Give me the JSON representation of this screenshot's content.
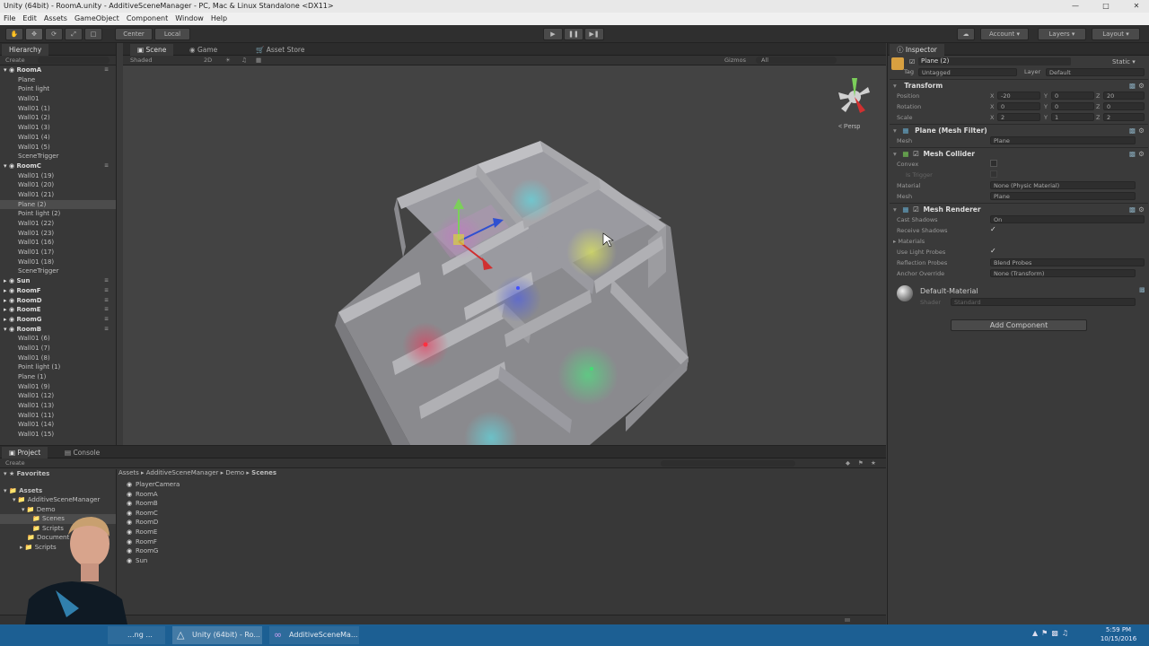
{
  "window": {
    "title": "Unity (64bit) - RoomA.unity - AdditiveSceneManager - PC, Mac & Linux Standalone <DX11>"
  },
  "menu": [
    "File",
    "Edit",
    "Assets",
    "GameObject",
    "Component",
    "Window",
    "Help"
  ],
  "toolbar": {
    "pivot": "Center",
    "space": "Local",
    "account": "Account",
    "layers": "Layers",
    "layout": "Layout"
  },
  "hierarchy": {
    "tab": "Hierarchy",
    "create": "Create",
    "rows": [
      {
        "label": "RoomA",
        "kind": "scene"
      },
      {
        "label": "Plane",
        "kind": "item"
      },
      {
        "label": "Point light",
        "kind": "item"
      },
      {
        "label": "Wall01",
        "kind": "item"
      },
      {
        "label": "Wall01 (1)",
        "kind": "item"
      },
      {
        "label": "Wall01 (2)",
        "kind": "item"
      },
      {
        "label": "Wall01 (3)",
        "kind": "item"
      },
      {
        "label": "Wall01 (4)",
        "kind": "item"
      },
      {
        "label": "Wall01 (5)",
        "kind": "item"
      },
      {
        "label": "SceneTrigger",
        "kind": "item"
      },
      {
        "label": "RoomC",
        "kind": "scene"
      },
      {
        "label": "Wall01 (19)",
        "kind": "item"
      },
      {
        "label": "Wall01 (20)",
        "kind": "item"
      },
      {
        "label": "Wall01 (21)",
        "kind": "item"
      },
      {
        "label": "Plane (2)",
        "kind": "sel"
      },
      {
        "label": "Point light (2)",
        "kind": "item"
      },
      {
        "label": "Wall01 (22)",
        "kind": "item"
      },
      {
        "label": "Wall01 (23)",
        "kind": "item"
      },
      {
        "label": "Wall01 (16)",
        "kind": "item"
      },
      {
        "label": "Wall01 (17)",
        "kind": "item"
      },
      {
        "label": "Wall01 (18)",
        "kind": "item"
      },
      {
        "label": "SceneTrigger",
        "kind": "item"
      },
      {
        "label": "Sun",
        "kind": "scene"
      },
      {
        "label": "RoomF",
        "kind": "scene"
      },
      {
        "label": "RoomD",
        "kind": "scene"
      },
      {
        "label": "RoomE",
        "kind": "scene"
      },
      {
        "label": "RoomG",
        "kind": "scene"
      },
      {
        "label": "RoomB",
        "kind": "scene"
      },
      {
        "label": "Wall01 (6)",
        "kind": "item"
      },
      {
        "label": "Wall01 (7)",
        "kind": "item"
      },
      {
        "label": "Wall01 (8)",
        "kind": "item"
      },
      {
        "label": "Point light (1)",
        "kind": "item"
      },
      {
        "label": "Plane (1)",
        "kind": "item"
      },
      {
        "label": "Wall01 (9)",
        "kind": "item"
      },
      {
        "label": "Wall01 (12)",
        "kind": "item"
      },
      {
        "label": "Wall01 (13)",
        "kind": "item"
      },
      {
        "label": "Wall01 (11)",
        "kind": "item"
      },
      {
        "label": "Wall01 (14)",
        "kind": "item"
      },
      {
        "label": "Wall01 (15)",
        "kind": "item"
      }
    ]
  },
  "scene": {
    "tabs": [
      "Scene",
      "Game",
      "Asset Store"
    ],
    "shading": "Shaded",
    "mode2d": "2D",
    "gizmos": "Gizmos",
    "search": "All",
    "persp": "< Persp"
  },
  "inspector": {
    "tab": "Inspector",
    "object_name": "Plane (2)",
    "static": "Static",
    "tag_label": "Tag",
    "tag_value": "Untagged",
    "layer_label": "Layer",
    "layer_value": "Default",
    "transform": {
      "title": "Transform",
      "position": {
        "label": "Position",
        "x": "-20",
        "y": "0",
        "z": "20"
      },
      "rotation": {
        "label": "Rotation",
        "x": "0",
        "y": "0",
        "z": "0"
      },
      "scale": {
        "label": "Scale",
        "x": "2",
        "y": "1",
        "z": "2"
      }
    },
    "mesh_filter": {
      "title": "Plane (Mesh Filter)",
      "mesh_label": "Mesh",
      "mesh_value": "Plane"
    },
    "mesh_collider": {
      "title": "Mesh Collider",
      "convex": "Convex",
      "is_trigger": "Is Trigger",
      "material_label": "Material",
      "material_value": "None (Physic Material)",
      "mesh_label": "Mesh",
      "mesh_value": "Plane"
    },
    "mesh_renderer": {
      "title": "Mesh Renderer",
      "cast_shadows": "Cast Shadows",
      "cast_shadows_value": "On",
      "receive_shadows": "Receive Shadows",
      "materials": "Materials",
      "use_light_probes": "Use Light Probes",
      "reflection_probes": "Reflection Probes",
      "reflection_probes_value": "Blend Probes",
      "anchor_override": "Anchor Override",
      "anchor_override_value": "None (Transform)"
    },
    "material": {
      "name": "Default-Material",
      "shader_label": "Shader",
      "shader_value": "Standard"
    },
    "add_component": "Add Component"
  },
  "project": {
    "tabs": [
      "Project",
      "Console"
    ],
    "create": "Create",
    "breadcrumb": [
      "Assets",
      "AdditiveSceneManager",
      "Demo",
      "Scenes"
    ],
    "tree": [
      "Favorites",
      "Assets",
      "AdditiveSceneManager",
      "Demo",
      "Scenes",
      "Scripts",
      "Document",
      "Scripts"
    ],
    "files": [
      "PlayerCamera",
      "RoomA",
      "RoomB",
      "RoomC",
      "RoomD",
      "RoomE",
      "RoomF",
      "RoomG",
      "Sun"
    ]
  },
  "taskbar": {
    "tasks": [
      "...ng ...",
      "Unity (64bit) - Ro...",
      "AdditiveSceneMa..."
    ],
    "time": "5:59 PM",
    "date": "10/15/2016"
  },
  "colors": {
    "accent_light_green": "#7ccf5a",
    "accent_yellow": "#d8e060",
    "accent_red": "#d03030",
    "accent_blue": "#3050d0",
    "accent_cyan": "#60d8e0"
  }
}
